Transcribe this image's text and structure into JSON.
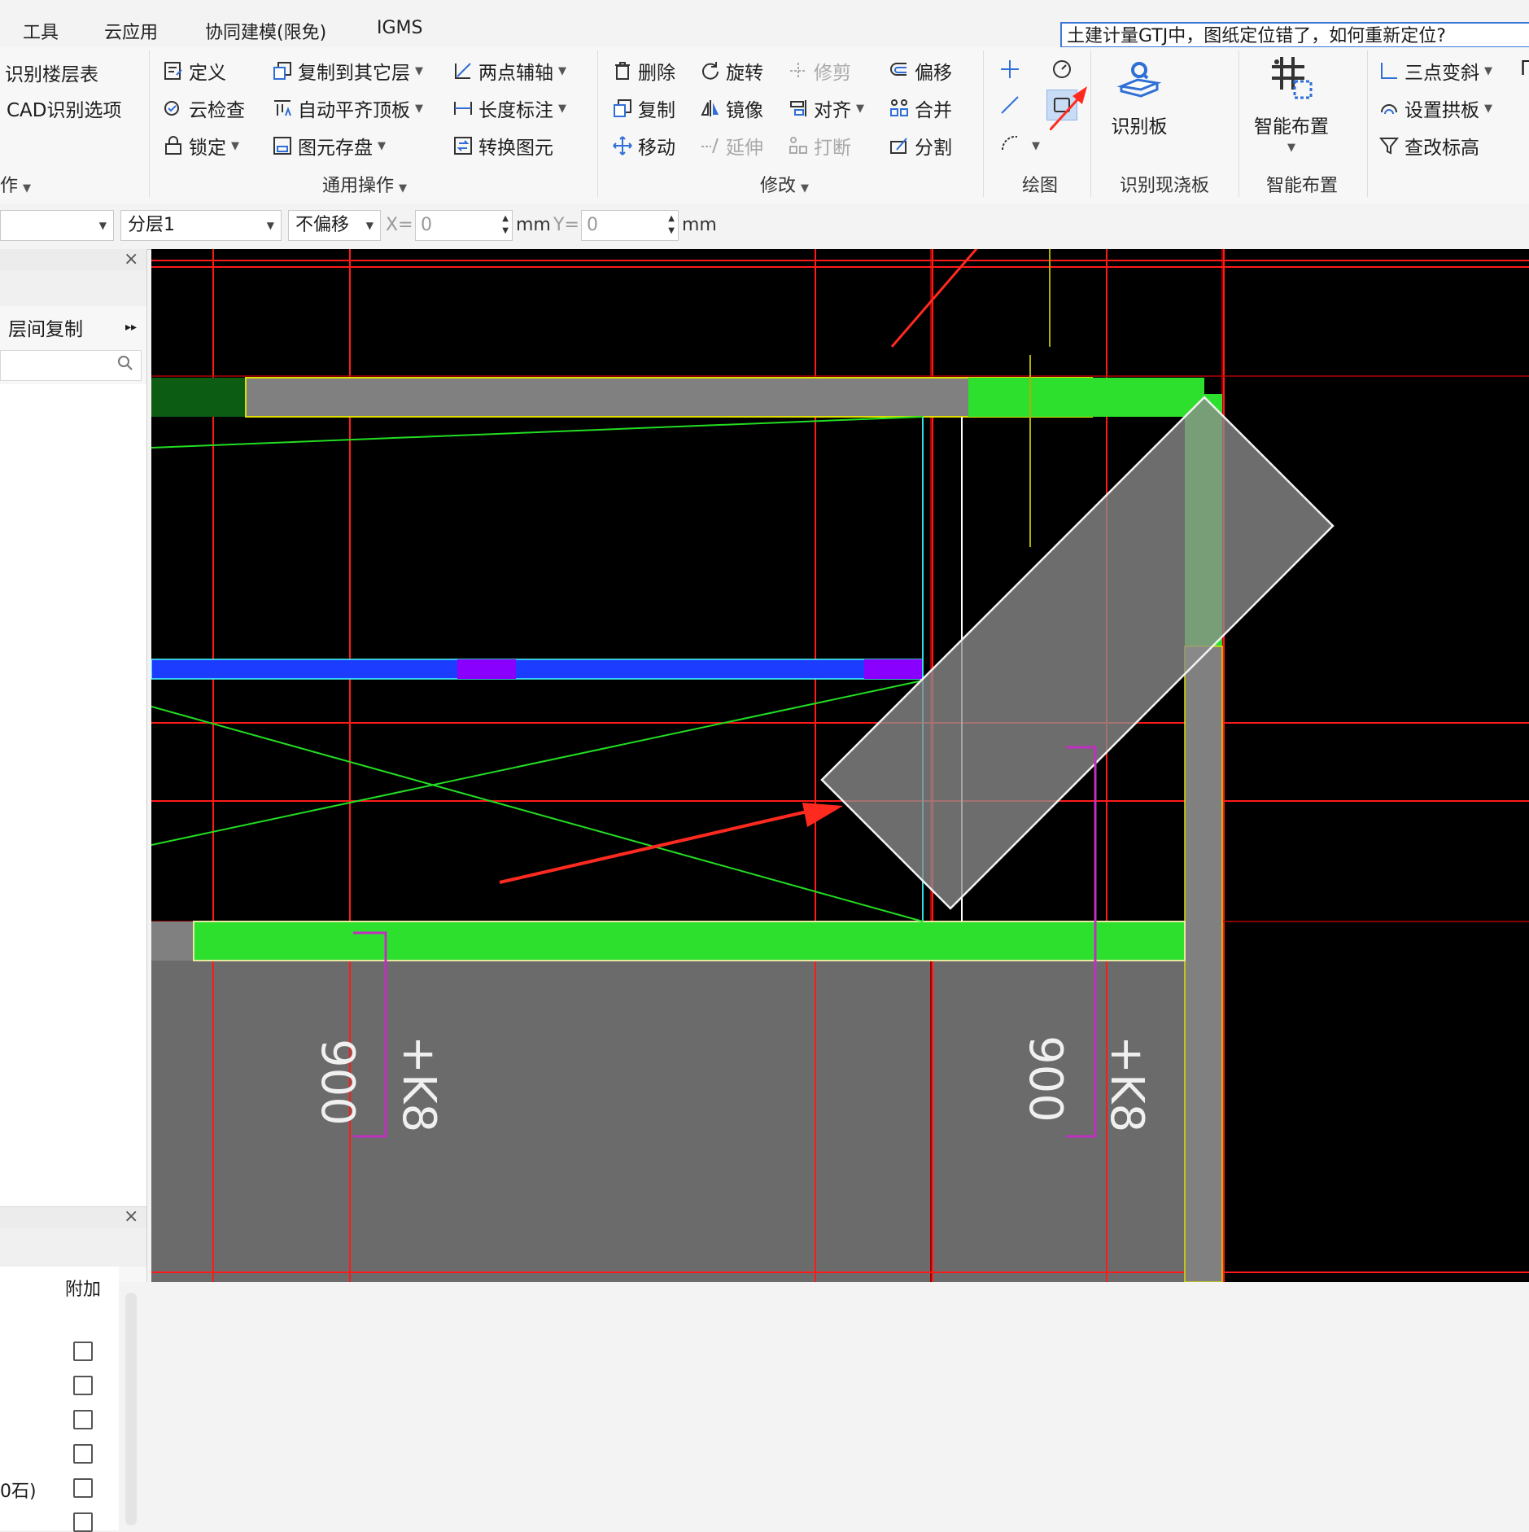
{
  "menu": {
    "items": [
      "工具",
      "云应用",
      "协同建模(限免)",
      "IGMS"
    ],
    "search_value": "土建计量GTJ中，图纸定位错了，如何重新定位?"
  },
  "ribbon": {
    "col_floor": {
      "recognize_floor_table": "识别楼层表",
      "cad_options": "CAD识别选项",
      "group_label_partial": "作"
    },
    "common": {
      "define": "定义",
      "copy_to_layer": "复制到其它层",
      "two_point_axis": "两点辅轴",
      "cloud_check": "云检查",
      "auto_align_top": "自动平齐顶板",
      "length_dim": "长度标注",
      "lock": "锁定",
      "save_element": "图元存盘",
      "convert_element": "转换图元",
      "group_label": "通用操作"
    },
    "modify": {
      "delete": "删除",
      "rotate": "旋转",
      "trim": "修剪",
      "offset": "偏移",
      "copy": "复制",
      "mirror": "镜像",
      "align": "对齐",
      "merge": "合并",
      "move": "移动",
      "extend": "延伸",
      "break": "打断",
      "split": "分割",
      "group_label": "修改"
    },
    "draw": {
      "group_label": "绘图"
    },
    "recognize_slab": {
      "button": "识别板",
      "group_label": "识别现浇板"
    },
    "smart_layout": {
      "button": "智能布置",
      "group_label": "智能布置"
    },
    "slope": {
      "three_point_slope": "三点变斜",
      "set_arch_slab": "设置拱板",
      "check_elevation": "查改标高"
    }
  },
  "toolbar": {
    "layer_value": "分层1",
    "offset_value": "不偏移",
    "x_label": "X=",
    "x_value": "0",
    "mm1": "mm",
    "y_label": "Y=",
    "y_value": "0",
    "mm2": "mm"
  },
  "left_panel": {
    "floor_copy": "层间复制",
    "attach_header": "附加",
    "partial_row_label": "0石)"
  },
  "canvas": {
    "dim_label": "900",
    "axis_label": "+K8",
    "colors": {
      "grid": "#ff0000",
      "slab_gray": "#808080",
      "beam_green": "#2ee02e",
      "beam_blue": "#1c3cff",
      "beam_purple": "#8a00ff",
      "slab_lower": "#6b6b6b",
      "arrow": "#ff2a1f",
      "dim": "#c030c0"
    }
  }
}
